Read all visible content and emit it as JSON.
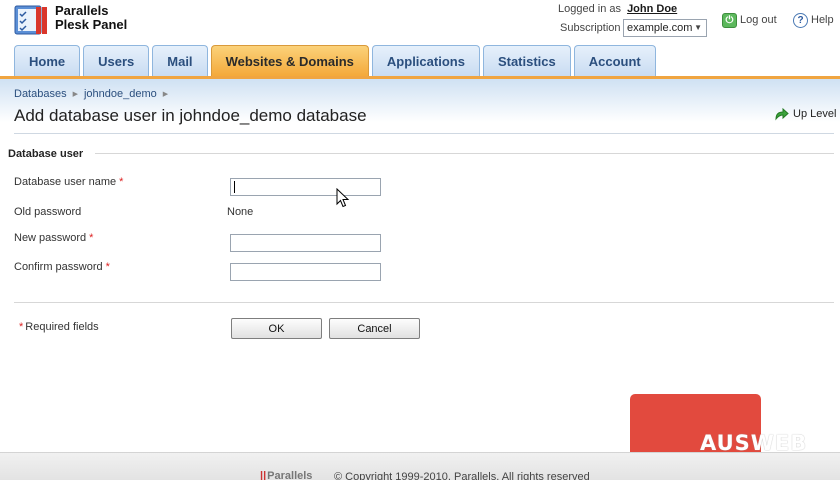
{
  "header": {
    "brand_line1": "Parallels",
    "brand_line2": "Plesk Panel",
    "logged_in_label": "Logged in as",
    "user_name": "John Doe",
    "subscription_label": "Subscription",
    "subscription_value": "example.com",
    "logout_label": "Log out",
    "help_label": "Help"
  },
  "tabs": [
    {
      "label": "Home",
      "active": false
    },
    {
      "label": "Users",
      "active": false
    },
    {
      "label": "Mail",
      "active": false
    },
    {
      "label": "Websites & Domains",
      "active": true
    },
    {
      "label": "Applications",
      "active": false
    },
    {
      "label": "Statistics",
      "active": false
    },
    {
      "label": "Account",
      "active": false
    }
  ],
  "breadcrumbs": [
    "Databases",
    "johndoe_demo"
  ],
  "page": {
    "title": "Add database user in johndoe_demo database",
    "up_level": "Up Level"
  },
  "form": {
    "section_title": "Database user",
    "fields": {
      "db_user_name": {
        "label": "Database user name",
        "required": true,
        "value": ""
      },
      "old_password": {
        "label": "Old password",
        "value": "None"
      },
      "new_password": {
        "label": "New password",
        "required": true,
        "value": ""
      },
      "confirm_password": {
        "label": "Confirm password",
        "required": true,
        "value": ""
      }
    },
    "required_note": "Required fields",
    "required_star": "*",
    "ok_label": "OK",
    "cancel_label": "Cancel"
  },
  "footer": {
    "logo_text": "Parallels",
    "copyright": "© Copyright 1999-2010, Parallels. All rights reserved"
  },
  "watermark": {
    "text": "AUSWEB"
  },
  "colors": {
    "active_tab": "#f4a93a",
    "tab": "#c9dcf2",
    "required_star": "#dd2222",
    "watermark": "#e24a3e"
  }
}
